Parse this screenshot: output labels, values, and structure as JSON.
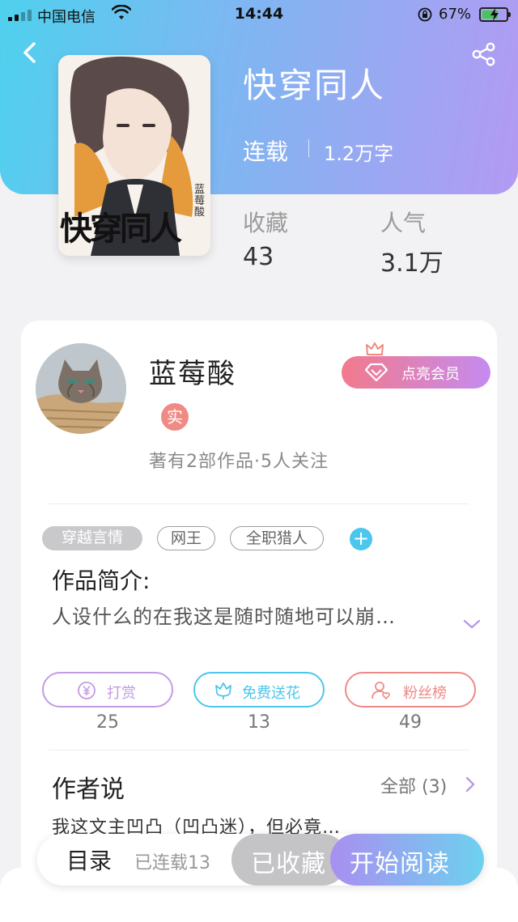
{
  "status_bar": {
    "carrier": "中国电信",
    "time": "14:44",
    "battery_percent": "67%",
    "battery_level": 0.67,
    "icons": [
      "signal-icon",
      "wifi-icon",
      "orientation-lock-icon",
      "battery-charging-icon"
    ]
  },
  "header": {
    "back_icon": "chevron-left-icon",
    "share_icon": "share-icon",
    "gradient_colors": [
      "#4fd1ee",
      "#b39af2"
    ]
  },
  "book": {
    "cover_title": "快穿同人",
    "cover_author": "蓝莓酸",
    "title": "快穿同人",
    "status": "连载",
    "word_count": "1.2万字",
    "stats": [
      {
        "label": "收藏",
        "value": "43"
      },
      {
        "label": "人气",
        "value": "3.1万"
      }
    ]
  },
  "author": {
    "name": "蓝莓酸",
    "verified_badge": "实",
    "meta": "著有2部作品·5人关注",
    "vip_button": "点亮会员"
  },
  "tags": {
    "primary": "穿越言情",
    "items": [
      "网王",
      "全职猎人"
    ],
    "add_symbol": "+"
  },
  "intro": {
    "title": "作品简介:",
    "text": "人设什么的在我这是随时随地可以崩…"
  },
  "actions": [
    {
      "label": "打赏",
      "count": "25",
      "color": "#c39be3",
      "icon": "yen-coin-icon"
    },
    {
      "label": "免费送花",
      "count": "13",
      "color": "#4cc6ec",
      "icon": "flower-icon"
    },
    {
      "label": "粉丝榜",
      "count": "49",
      "color": "#ee8a86",
      "icon": "fan-user-icon"
    }
  ],
  "author_says": {
    "title": "作者说",
    "all_label": "全部 (3)",
    "text": "我这文主凹凸（凹凸迷），但必竟…"
  },
  "bottom_bar": {
    "toc": "目录",
    "serial": "已连载13",
    "favorited": "已收藏",
    "start_reading": "开始阅读"
  }
}
